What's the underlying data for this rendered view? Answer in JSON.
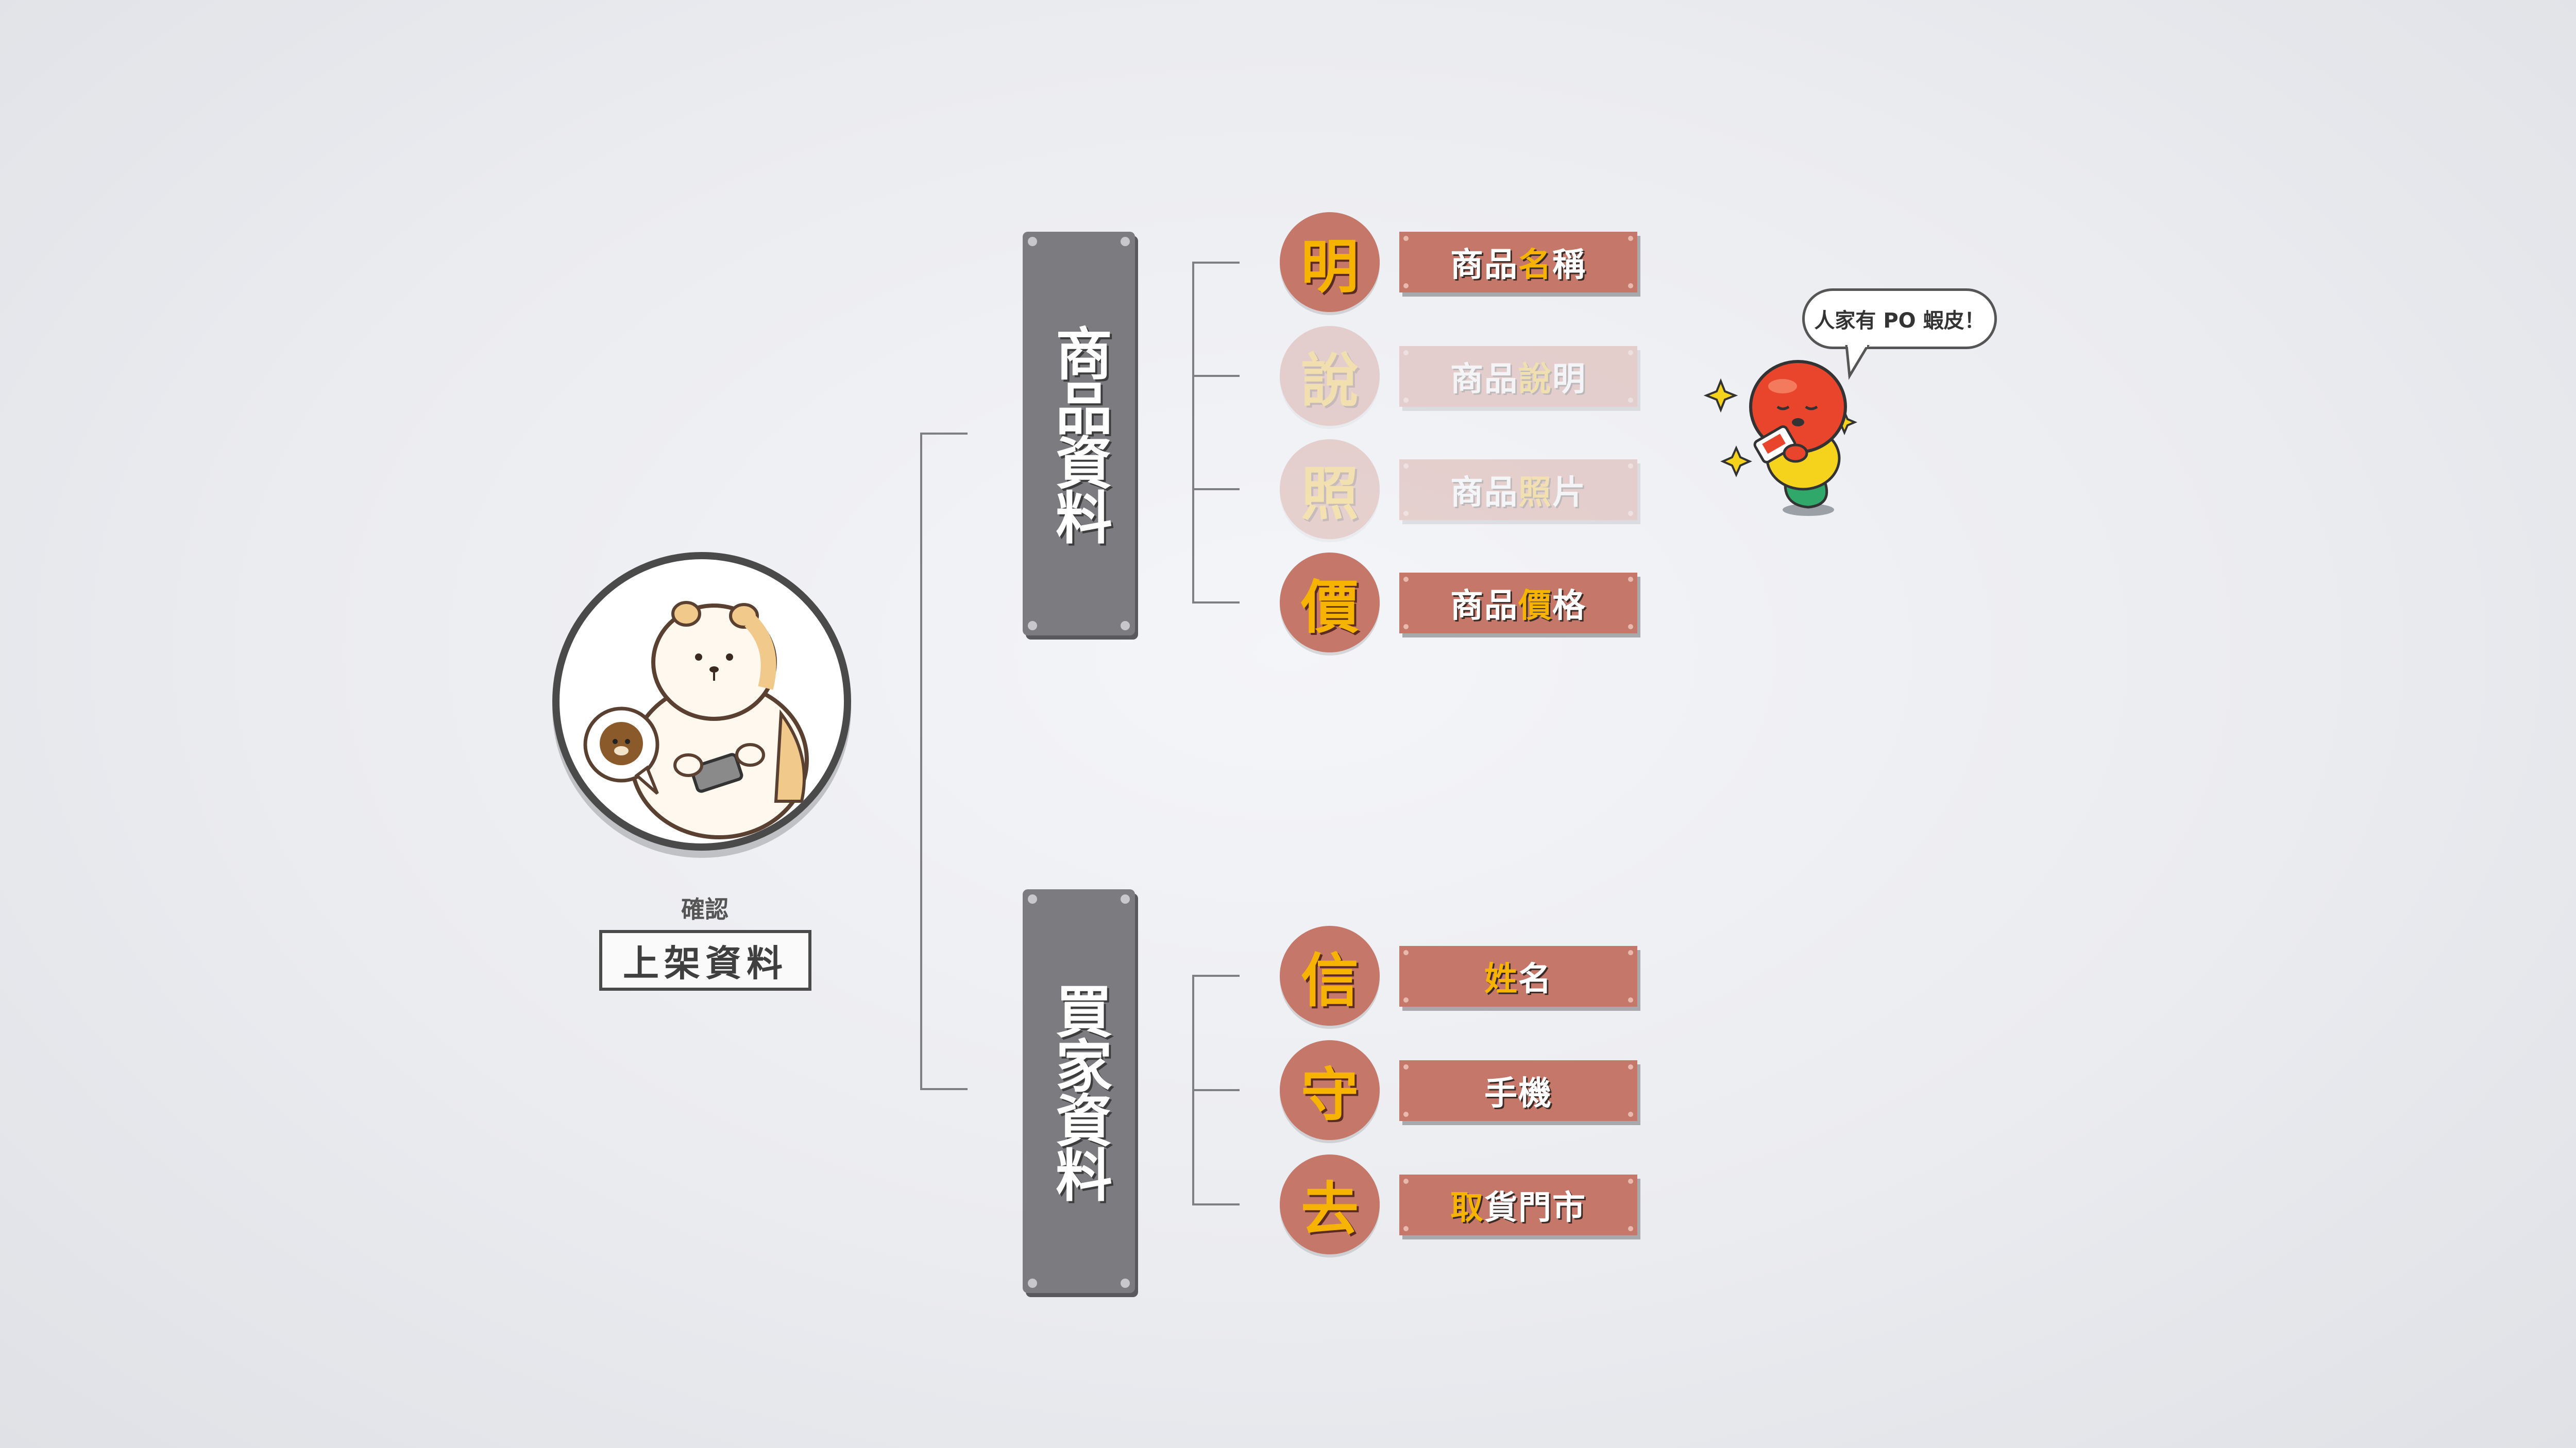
{
  "root": {
    "subtitle": "確認",
    "title": "上架資料"
  },
  "categories": [
    {
      "label": "商品資料",
      "items": [
        {
          "char": "明",
          "label_pre": "商品",
          "label_hl": "名",
          "label_post": "稱",
          "faded": false
        },
        {
          "char": "說",
          "label_pre": "商品",
          "label_hl": "說",
          "label_post": "明",
          "faded": true
        },
        {
          "char": "照",
          "label_pre": "商品",
          "label_hl": "照",
          "label_post": "片",
          "faded": true
        },
        {
          "char": "價",
          "label_pre": "商品",
          "label_hl": "價",
          "label_post": "格",
          "faded": false
        }
      ]
    },
    {
      "label": "買家資料",
      "items": [
        {
          "char": "信",
          "label_pre": "",
          "label_hl": "姓",
          "label_post": "名",
          "faded": false
        },
        {
          "char": "守",
          "label_pre": "",
          "label_hl": "",
          "label_post": "手機",
          "faded": false
        },
        {
          "char": "去",
          "label_pre": "",
          "label_hl": "取",
          "label_post": "貨門市",
          "faded": false
        }
      ]
    }
  ],
  "mascot_bubble": "人家有 PO 蝦皮！",
  "colors": {
    "accent": "#c5786a",
    "highlight": "#f6b400",
    "plate": "#7c7c80",
    "line": "#7d7f83"
  }
}
